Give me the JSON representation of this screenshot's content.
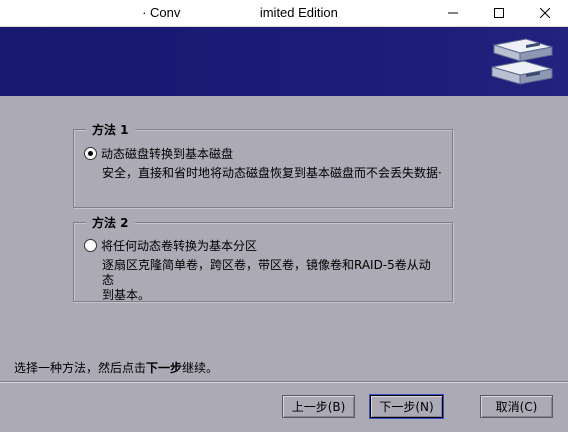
{
  "window": {
    "title": "· Conv                      imited Edition"
  },
  "method1": {
    "legend": "方法 1",
    "option_label": "动态磁盘转换到基本磁盘",
    "description": "安全，直接和省时地将动态磁盘恢复到基本磁盘而不会丢失数据·",
    "selected": true
  },
  "method2": {
    "legend": "方法 2",
    "option_label": "将任何动态卷转换为基本分区",
    "description_line1": "逐扇区克隆简单卷，跨区卷，带区卷，镜像卷和RAID-5卷从动态",
    "description_line2": "到基本。",
    "selected": false
  },
  "instruction": {
    "prefix": "选择一种方法，然后点击",
    "emphasis": "下一步",
    "suffix": "继续。"
  },
  "buttons": {
    "back": "上一步(B)",
    "next": "下一步(N)",
    "cancel": "取消(C)"
  },
  "colors": {
    "banner": "#1c1c78",
    "background": "#abaab5"
  }
}
